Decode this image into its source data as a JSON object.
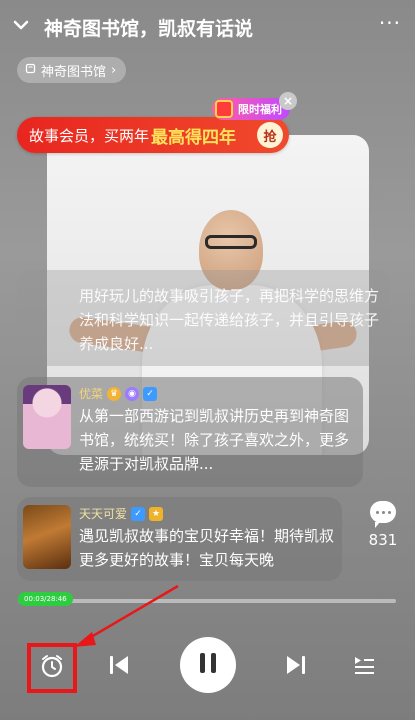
{
  "header": {
    "title": "神奇图书馆，凯叔有话说",
    "more": "···"
  },
  "chip": {
    "label": "神奇图书馆",
    "chevron": "›"
  },
  "promo": {
    "text_prefix": "故事会员，买两年",
    "text_highlight": "最高得四年",
    "grab": "抢",
    "tag": "限时福利",
    "close": "×"
  },
  "comments": [
    {
      "text": "用好玩儿的故事吸引孩子，再把科学的思维方法和科学知识一起传递给孩子，并且引导孩子养成良好..."
    },
    {
      "user": "优菜",
      "text": "从第一部西游记到凯叔讲历史再到神奇图书馆，统统买！除了孩子喜欢之外，更多是源于对凯叔品牌..."
    },
    {
      "user": "天天可爱",
      "text": "遇见凯叔故事的宝贝好幸福！期待凯叔更多更好的故事！宝贝每天晚"
    }
  ],
  "comment_count": "831",
  "player": {
    "time": "00:03/28:46",
    "progress": 0.02,
    "accent": "#2ecc40"
  },
  "icons": {
    "back": "chevron-down-icon",
    "timer": "alarm-clock-icon",
    "prev": "skip-previous-icon",
    "pause": "pause-icon",
    "next": "skip-next-icon",
    "playlist": "playlist-icon",
    "chat": "comment-icon"
  },
  "annotation_color": "#e8181a"
}
